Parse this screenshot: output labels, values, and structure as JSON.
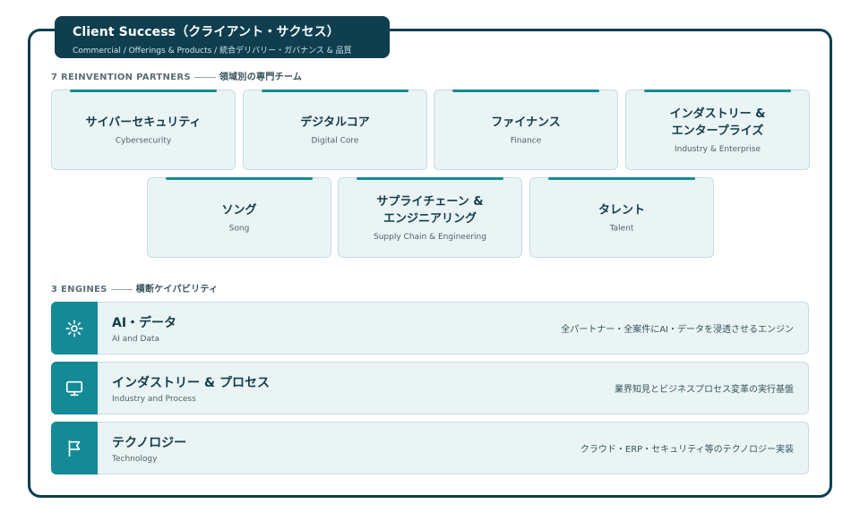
{
  "header": {
    "title": "Client Success（クライアント・サクセス）",
    "subtitle": "Commercial / Offerings & Products / 統合デリバリー・ガバナンス & 品質"
  },
  "partners_section": {
    "label_en": "7 REINVENTION PARTNERS",
    "label_jp": "領域別の専門チーム"
  },
  "partners": [
    {
      "jp": "サイバーセキュリティ",
      "en": "Cybersecurity"
    },
    {
      "jp": "デジタルコア",
      "en": "Digital Core"
    },
    {
      "jp": "ファイナンス",
      "en": "Finance"
    },
    {
      "jp": "インダストリー &\nエンタープライズ",
      "en": "Industry & Enterprise"
    },
    {
      "jp": "ソング",
      "en": "Song"
    },
    {
      "jp": "サプライチェーン &\nエンジニアリング",
      "en": "Supply Chain & Engineering"
    },
    {
      "jp": "タレント",
      "en": "Talent"
    }
  ],
  "engines_section": {
    "label_en": "3 ENGINES",
    "label_jp": "横断ケイパビリティ"
  },
  "engines": [
    {
      "jp": "AI・データ",
      "en": "AI and Data",
      "desc": "全パートナー・全案件にAI・データを浸透させるエンジン",
      "icon": "sun-icon"
    },
    {
      "jp": "インダストリー & プロセス",
      "en": "Industry and Process",
      "desc": "業界知見とビジネスプロセス変革の実行基盤",
      "icon": "monitor-icon"
    },
    {
      "jp": "テクノロジー",
      "en": "Technology",
      "desc": "クラウド・ERP・セキュリティ等のテクノロジー実装",
      "icon": "flag-icon"
    }
  ],
  "colors": {
    "primary": "#0f3f4f",
    "accent": "#138a96",
    "card_bg": "#eaf4f5"
  }
}
